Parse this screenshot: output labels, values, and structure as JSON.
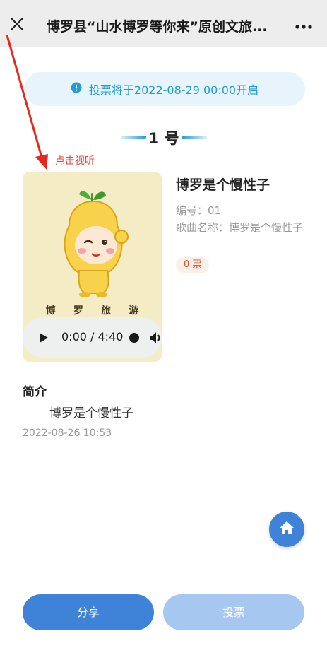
{
  "header": {
    "title": "博罗县“山水博罗等你来”原创文旅...",
    "close_icon": "close-icon",
    "more_icon": "more-icon"
  },
  "notice": {
    "icon": "info-icon",
    "text": "投票将于2022-08-29 00:00开启",
    "color": "#1f9bd6"
  },
  "entry": {
    "number_label": "1 号",
    "listen_hint": "点击视听",
    "cover_text": [
      "博",
      "罗",
      "旅",
      "游"
    ],
    "player": {
      "time": "0:00 / 4:40",
      "play_icon": "play-icon",
      "volume_icon": "volume-icon"
    },
    "title": "博罗是个慢性子",
    "id_line": "编号：01",
    "song_name_line": "歌曲名称：博罗是个慢性子",
    "votes": "0 票"
  },
  "intro": {
    "label": "简介",
    "text": "博罗是个慢性子",
    "timestamp": "2022-08-26 10:53"
  },
  "floating": {
    "home_icon": "home-icon"
  },
  "actions": {
    "share_label": "分享",
    "vote_label": "投票"
  },
  "colors": {
    "primary": "#3f83d9",
    "primary_disabled": "#a6c7ef",
    "accent_red": "#e8423a",
    "vote_badge": "#e0501f"
  }
}
